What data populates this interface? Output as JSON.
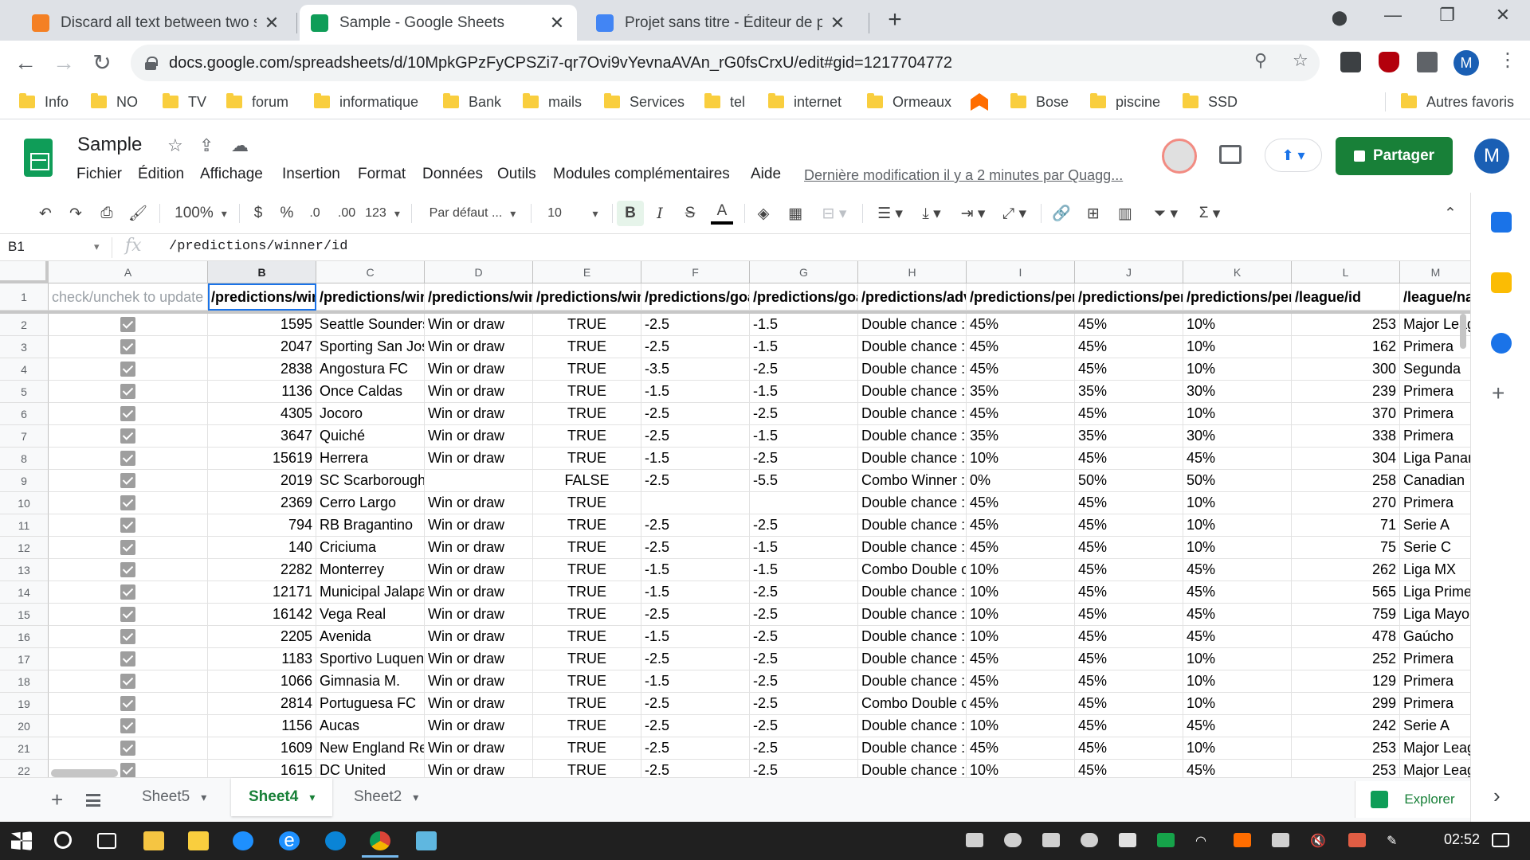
{
  "browser": {
    "tabs": [
      {
        "title": "Discard all text between two spec",
        "favicon_color": "#f48024",
        "active": false
      },
      {
        "title": "Sample - Google Sheets",
        "favicon_color": "#0f9d58",
        "active": true
      },
      {
        "title": "Projet sans titre - Éditeur de proj",
        "favicon_color": "#4285f4",
        "active": false
      }
    ],
    "tab_close_glyph": "✕",
    "new_tab_glyph": "+",
    "url": "docs.google.com/spreadsheets/d/10MpkGPzFyCPSZi7-qr7Ovi9vYevnaAVAn_rG0fsCrxU/edit#gid=1217704772",
    "profile_initial": "M",
    "bookmarks": [
      "Info",
      "NO",
      "TV",
      "forum",
      "informatique",
      "Bank",
      "mails",
      "Services",
      "tel",
      "internet",
      "Ormeaux",
      "",
      "Bose",
      "piscine",
      "SSD"
    ],
    "other_bookmarks": "Autres favoris"
  },
  "sheets": {
    "title": "Sample",
    "menus": [
      "Fichier",
      "Édition",
      "Affichage",
      "Insertion",
      "Format",
      "Données",
      "Outils",
      "Modules complémentaires",
      "Aide"
    ],
    "last_edit": "Dernière modification il y a 2 minutes par Quagg...",
    "share_label": "Partager",
    "account_initial": "M",
    "accent": "#188038"
  },
  "toolbar": {
    "zoom": "100%",
    "currency": "$",
    "percent": "%",
    "decrease_decimals": ".0",
    "increase_decimals": ".00",
    "more_formats": "123",
    "font": "Par défaut ...",
    "font_size": "10",
    "bold": "B",
    "italic": "I",
    "strike": "S",
    "text_color": "A",
    "sigma": "Σ"
  },
  "formula_bar": {
    "cell_ref": "B1",
    "fx": "fx",
    "content": "/predictions/winner/id"
  },
  "grid": {
    "columns": [
      "A",
      "B",
      "C",
      "D",
      "E",
      "F",
      "G",
      "H",
      "I",
      "J",
      "K",
      "L",
      "M"
    ],
    "selected_column": "B",
    "header_row": [
      "check/unchek to update",
      "/predictions/winner/id",
      "/predictions/winner/name",
      "/predictions/winner/comment",
      "/predictions/win_or_draw",
      "/predictions/goals/home",
      "/predictions/goals/away",
      "/predictions/advice",
      "/predictions/percent/home",
      "/predictions/percent/draw",
      "/predictions/percent/away",
      "/league/id",
      "/league/name"
    ],
    "rows": [
      [
        "2",
        "1595",
        "Seattle Sounders",
        "Win or draw",
        "TRUE",
        "-2.5",
        "-1.5",
        "Double chance : ",
        "45%",
        "45%",
        "10%",
        "253",
        "Major League"
      ],
      [
        "3",
        "2047",
        "Sporting San Jose",
        "Win or draw",
        "TRUE",
        "-2.5",
        "-1.5",
        "Double chance : ",
        "45%",
        "45%",
        "10%",
        "162",
        "Primera"
      ],
      [
        "4",
        "2838",
        "Angostura FC",
        "Win or draw",
        "TRUE",
        "-3.5",
        "-2.5",
        "Double chance : ",
        "45%",
        "45%",
        "10%",
        "300",
        "Segunda"
      ],
      [
        "5",
        "1136",
        "Once Caldas",
        "Win or draw",
        "TRUE",
        "-1.5",
        "-1.5",
        "Double chance : ",
        "35%",
        "35%",
        "30%",
        "239",
        "Primera"
      ],
      [
        "6",
        "4305",
        "Jocoro",
        "Win or draw",
        "TRUE",
        "-2.5",
        "-2.5",
        "Double chance : ",
        "45%",
        "45%",
        "10%",
        "370",
        "Primera"
      ],
      [
        "7",
        "3647",
        "Quiché",
        "Win or draw",
        "TRUE",
        "-2.5",
        "-1.5",
        "Double chance : ",
        "35%",
        "35%",
        "30%",
        "338",
        "Primera"
      ],
      [
        "8",
        "15619",
        "Herrera",
        "Win or draw",
        "TRUE",
        "-1.5",
        "-2.5",
        "Double chance : ",
        "10%",
        "45%",
        "45%",
        "304",
        "Liga Panameña"
      ],
      [
        "9",
        "2019",
        "SC Scarborough",
        "",
        "FALSE",
        "-2.5",
        "-5.5",
        "Combo Winner : ",
        "0%",
        "50%",
        "50%",
        "258",
        "Canadian"
      ],
      [
        "10",
        "2369",
        "Cerro Largo",
        "Win or draw",
        "TRUE",
        "",
        "",
        "Double chance : ",
        "45%",
        "45%",
        "10%",
        "270",
        "Primera"
      ],
      [
        "11",
        "794",
        "RB Bragantino",
        "Win or draw",
        "TRUE",
        "-2.5",
        "-2.5",
        "Double chance : ",
        "45%",
        "45%",
        "10%",
        "71",
        "Serie A"
      ],
      [
        "12",
        "140",
        "Criciuma",
        "Win or draw",
        "TRUE",
        "-2.5",
        "-1.5",
        "Double chance : ",
        "45%",
        "45%",
        "10%",
        "75",
        "Serie C"
      ],
      [
        "13",
        "2282",
        "Monterrey",
        "Win or draw",
        "TRUE",
        "-1.5",
        "-1.5",
        "Combo Double chance",
        "10%",
        "45%",
        "45%",
        "262",
        "Liga MX"
      ],
      [
        "14",
        "12171",
        "Municipal Jalapa",
        "Win or draw",
        "TRUE",
        "-1.5",
        "-2.5",
        "Double chance : ",
        "10%",
        "45%",
        "45%",
        "565",
        "Liga Primera"
      ],
      [
        "15",
        "16142",
        "Vega Real",
        "Win or draw",
        "TRUE",
        "-2.5",
        "-2.5",
        "Double chance : ",
        "10%",
        "45%",
        "45%",
        "759",
        "Liga Mayor"
      ],
      [
        "16",
        "2205",
        "Avenida",
        "Win or draw",
        "TRUE",
        "-1.5",
        "-2.5",
        "Double chance : ",
        "10%",
        "45%",
        "45%",
        "478",
        "Gaúcho"
      ],
      [
        "17",
        "1183",
        "Sportivo Luqueno",
        "Win or draw",
        "TRUE",
        "-2.5",
        "-2.5",
        "Double chance : ",
        "45%",
        "45%",
        "10%",
        "252",
        "Primera"
      ],
      [
        "18",
        "1066",
        "Gimnasia M.",
        "Win or draw",
        "TRUE",
        "-1.5",
        "-2.5",
        "Double chance : ",
        "45%",
        "45%",
        "10%",
        "129",
        "Primera"
      ],
      [
        "19",
        "2814",
        "Portuguesa FC",
        "Win or draw",
        "TRUE",
        "-2.5",
        "-2.5",
        "Combo Double chance",
        "45%",
        "45%",
        "10%",
        "299",
        "Primera"
      ],
      [
        "20",
        "1156",
        "Aucas",
        "Win or draw",
        "TRUE",
        "-2.5",
        "-2.5",
        "Double chance : ",
        "10%",
        "45%",
        "45%",
        "242",
        "Serie A"
      ],
      [
        "21",
        "1609",
        "New England Revolution",
        "Win or draw",
        "TRUE",
        "-2.5",
        "-2.5",
        "Double chance : ",
        "45%",
        "45%",
        "10%",
        "253",
        "Major League"
      ],
      [
        "22",
        "1615",
        "DC United",
        "Win or draw",
        "TRUE",
        "-2.5",
        "-2.5",
        "Double chance : ",
        "10%",
        "45%",
        "45%",
        "253",
        "Major League"
      ]
    ]
  },
  "sheet_tabs": [
    "Sheet5",
    "Sheet4",
    "Sheet2"
  ],
  "active_sheet": "Sheet4",
  "explore_label": "Explorer",
  "taskbar": {
    "clock": "02:52"
  }
}
